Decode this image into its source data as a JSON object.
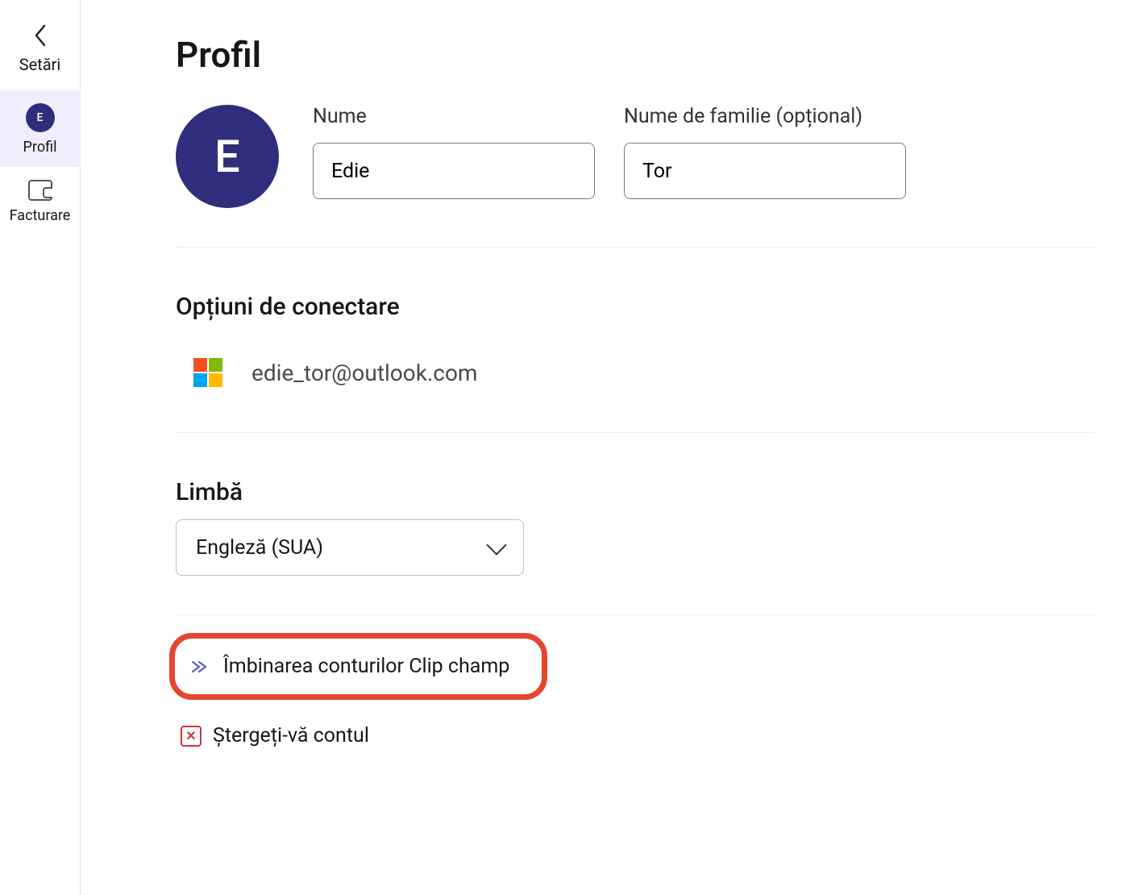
{
  "sidebar": {
    "header": "Setări",
    "items": [
      {
        "label": "Profil",
        "avatar_letter": "E"
      },
      {
        "label": "Facturare"
      }
    ]
  },
  "page": {
    "title": "Profil"
  },
  "profile": {
    "avatar_letter": "E",
    "first_name_label": "Nume",
    "first_name_value": "Edie",
    "last_name_label": "Nume de familie (opțional)",
    "last_name_value": "Tor"
  },
  "login_options": {
    "title": "Opțiuni de conectare",
    "email": "edie_tor@outlook.com"
  },
  "language": {
    "label": "Limbă",
    "selected": "Engleză (SUA)"
  },
  "actions": {
    "merge_label": "Îmbinarea conturilor Clip champ",
    "delete_label": "Ștergeți-vă contul"
  },
  "colors": {
    "accent": "#2f2e7c",
    "highlight": "#e7452f",
    "link": "#5b57c7",
    "danger": "#d13438"
  }
}
